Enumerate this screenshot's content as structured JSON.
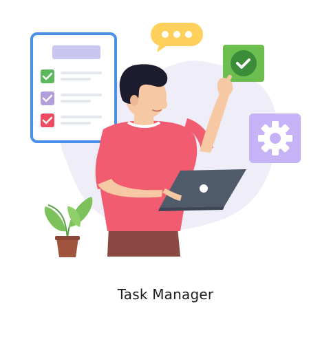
{
  "caption": {
    "text": "Task Manager"
  },
  "illustration": {
    "icons": [
      "checklist-board-icon",
      "chat-bubble-icon",
      "check-badge-icon",
      "gear-icon",
      "plant-icon",
      "laptop-icon"
    ],
    "colors": {
      "blob": "#eeedf8",
      "board_border": "#4a90e8",
      "board_header": "#c9c7ef",
      "check_green": "#5cb85c",
      "check_purple": "#b39ddb",
      "check_red": "#ef4b62",
      "chat_bubble": "#ffd15c",
      "badge_green": "#4caf50",
      "gear_tile": "#c6b3f7",
      "shirt": "#f25c70",
      "pants": "#8a4a43",
      "skin": "#f6c8a3",
      "hair": "#1d1b2e",
      "laptop": "#4f5a6b",
      "plant_leaf": "#7cc15a",
      "pot": "#a0533d"
    }
  }
}
